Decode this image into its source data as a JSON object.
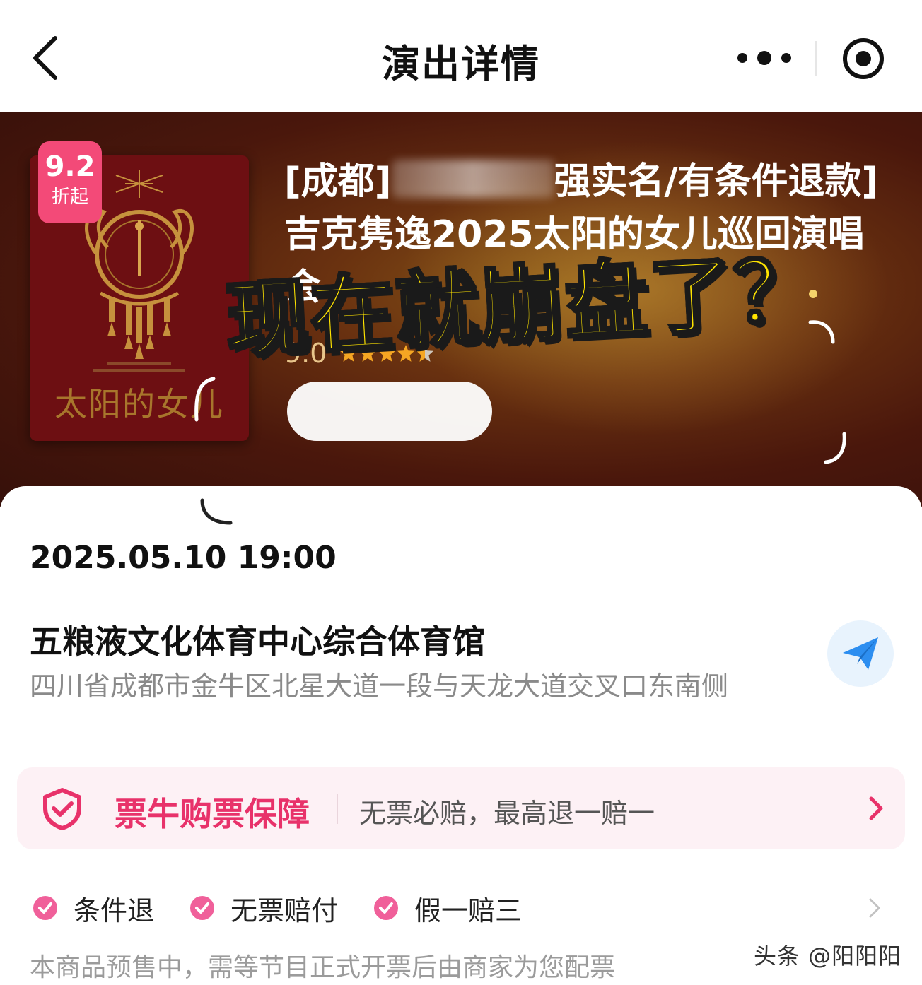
{
  "header": {
    "title": "演出详情",
    "back_icon": "chevron-left-icon",
    "more_icon": "more-dots-icon",
    "target_icon": "target-circle-icon"
  },
  "show": {
    "discount_value": "9.2",
    "discount_label": "折起",
    "title_prefix": "[成都]",
    "title_suffix": "强实名/有条件退款]吉克隽逸2025太阳的女儿巡回演唱会",
    "poster_title": "太阳的女儿",
    "rating": "9.0",
    "stars_filled": 4.5,
    "stars_total": 5
  },
  "overlay_caption": "现在就崩盘了？",
  "event": {
    "datetime": "2025.05.10 19:00",
    "venue_name": "五粮液文化体育中心综合体育馆",
    "venue_address": "四川省成都市金牛区北星大道一段与天龙大道交叉口东南侧",
    "nav_icon": "send-arrow-icon"
  },
  "guarantee": {
    "title": "票牛购票保障",
    "description": "无票必赔，最高退一赔一",
    "icon": "shield-check-icon"
  },
  "features": [
    "条件退",
    "无票赔付",
    "假一赔三"
  ],
  "presale_note": "本商品预售中，需等节目正式开票后由商家为您配票",
  "watermark": "头条 @阳阳阳",
  "colors": {
    "accent_pink": "#e8326a",
    "badge_pink": "#f34a78",
    "caption_yellow": "#ffe400",
    "rating_gold": "#e8c58b",
    "nav_blue": "#2d8ef0"
  }
}
